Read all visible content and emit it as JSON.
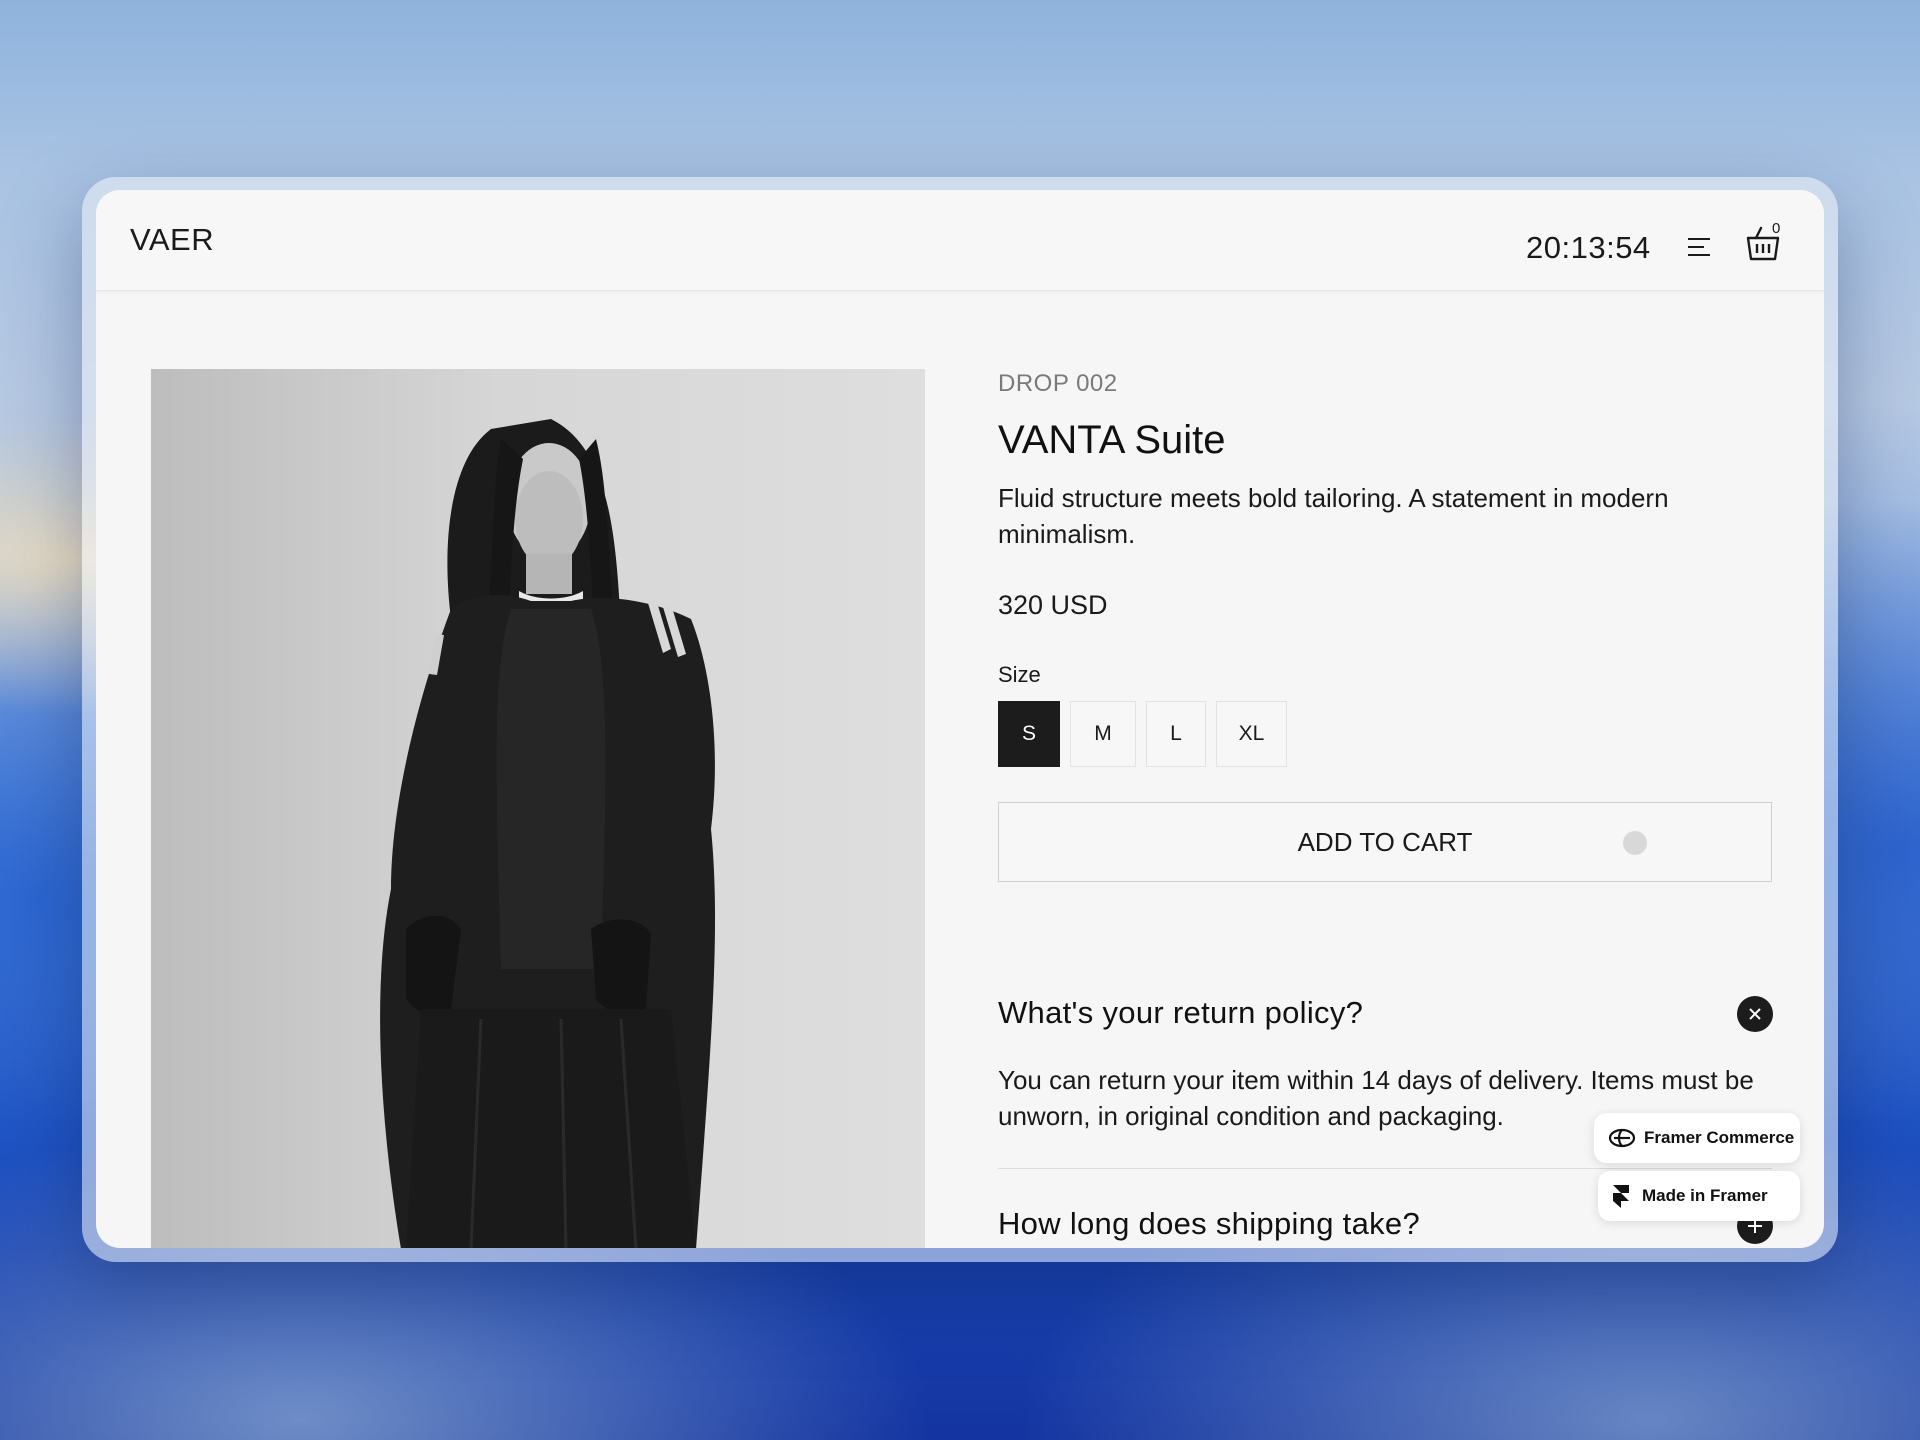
{
  "header": {
    "brand": "VAER",
    "clock": "20:13:54",
    "cart_count": "0",
    "menu_icon": "menu-icon",
    "cart_icon": "basket-icon"
  },
  "product": {
    "drop": "DROP 002",
    "title": "VANTA Suite",
    "description": "Fluid structure meets bold tailoring. A statement in modern minimalism.",
    "price": "320 USD",
    "size_label": "Size",
    "sizes": [
      "S",
      "M",
      "L",
      "XL"
    ],
    "selected_size": "S",
    "add_to_cart": "ADD TO CART"
  },
  "faq": [
    {
      "question": "What's your return policy?",
      "answer": "You can return your item within 14 days of delivery. Items must be unworn, in original condition and packaging.",
      "expanded": true,
      "toggle_icon": "close-icon"
    },
    {
      "question": "How long does shipping take?",
      "expanded": false,
      "toggle_icon": "plus-icon"
    }
  ],
  "badges": {
    "framer_commerce": "Framer Commerce",
    "made_in_framer": "Made in Framer"
  },
  "colors": {
    "accent": "#1c1c1c",
    "page_bg": "#f6f6f6",
    "muted_text": "#7a7a7a"
  }
}
